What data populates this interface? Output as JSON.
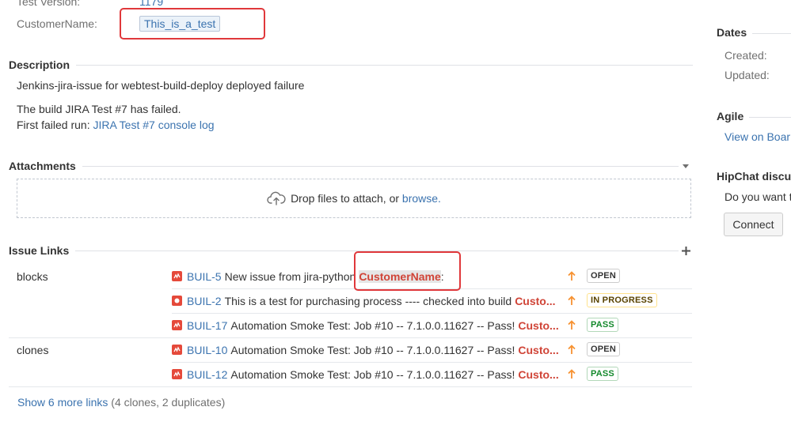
{
  "details": {
    "test_version_label": "Test Version:",
    "test_version_value": "1179",
    "customer_name_label": "CustomerName:",
    "customer_name_value": "This_is_a_test"
  },
  "description": {
    "title": "Description",
    "line1": "Jenkins-jira-issue for webtest-build-deploy deployed failure",
    "line2": "The build JIRA Test #7 has failed.",
    "line3_prefix": "First failed run: ",
    "line3_link": "JIRA Test #7 console log"
  },
  "attachments": {
    "title": "Attachments",
    "drop_text": "Drop files to attach, or ",
    "browse_link": "browse."
  },
  "issue_links": {
    "title": "Issue Links",
    "groups": [
      {
        "relation": "blocks",
        "items": [
          {
            "key": "BUIL-5",
            "summary": "New issue from jira-python",
            "custom": "CustomerName",
            "custom_suffix": ":",
            "status": "OPEN",
            "icon": "bug-icon"
          },
          {
            "key": "BUIL-2",
            "summary": "This is a test for purchasing process ---- checked into build",
            "custom": "Custo...",
            "status": "IN PROGRESS",
            "icon": "blocker-icon"
          },
          {
            "key": "BUIL-17",
            "summary": "Automation Smoke Test: Job #10 -- 7.1.0.0.11627 -- Pass!",
            "custom": "Custo...",
            "status": "PASS",
            "icon": "bug-icon"
          }
        ]
      },
      {
        "relation": "clones",
        "items": [
          {
            "key": "BUIL-10",
            "summary": "Automation Smoke Test: Job #10 -- 7.1.0.0.11627 -- Pass!",
            "custom": "Custo...",
            "status": "OPEN",
            "icon": "bug-icon"
          },
          {
            "key": "BUIL-12",
            "summary": "Automation Smoke Test: Job #10 -- 7.1.0.0.11627 -- Pass!",
            "custom": "Custo...",
            "status": "PASS",
            "icon": "bug-icon"
          }
        ]
      }
    ],
    "show_more_link": "Show 6 more links",
    "show_more_detail": " (4 clones, 2 duplicates)"
  },
  "sidebar": {
    "dates_title": "Dates",
    "created_label": "Created:",
    "updated_label": "Updated:",
    "agile_title": "Agile",
    "agile_link": "View on Boar",
    "hipchat_title": "HipChat discu",
    "hipchat_text": "Do you want t",
    "connect_button": "Connect"
  },
  "colors": {
    "link": "#3b73af",
    "annotation_red": "#e0383b",
    "priority_orange": "#f79232",
    "bug_red": "#e5493a"
  }
}
